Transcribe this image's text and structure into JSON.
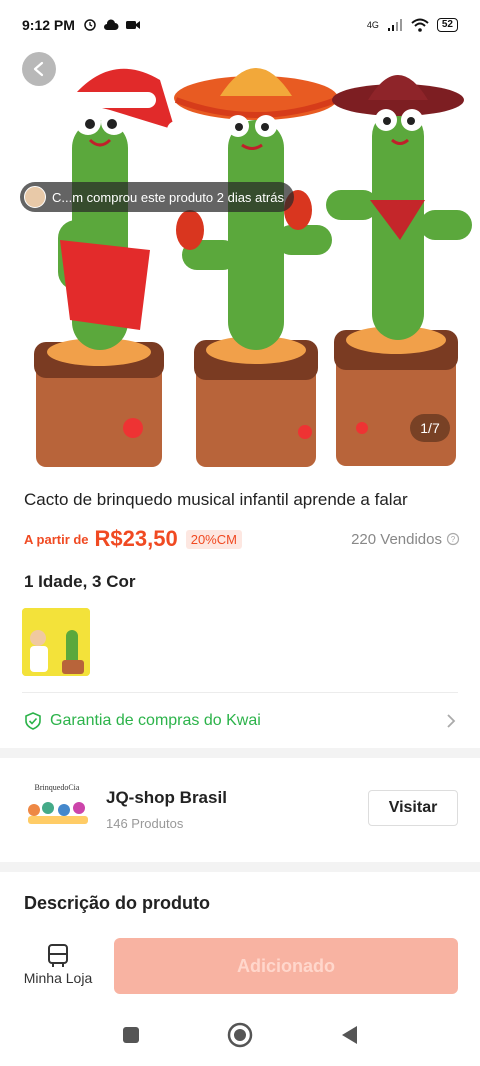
{
  "status_bar": {
    "time": "9:12 PM",
    "network": "4G",
    "battery": "52"
  },
  "hero": {
    "toast": "C...m comprou este produto 2 dias atrás",
    "page_indicator": "1/7"
  },
  "product": {
    "title": "Cacto de brinquedo musical infantil aprende a falar",
    "price_prefix": "A partir de",
    "price": "R$23,50",
    "discount": "20%CM",
    "sold": "220 Vendidos",
    "variants": "1 Idade, 3 Cor"
  },
  "guarantee": {
    "label": "Garantia de compras do Kwai"
  },
  "shop": {
    "logo_text": "BrinquedoCia",
    "name": "JQ-shop Brasil",
    "product_count": "146 Produtos",
    "visit_label": "Visitar"
  },
  "description": {
    "title": "Descrição do produto"
  },
  "bottom_bar": {
    "my_store_label": "Minha Loja",
    "add_label": "Adicionado"
  },
  "colors": {
    "accent": "#f04a22",
    "guarantee_green": "#2cb34a",
    "add_button_disabled": "#f8b3a2"
  },
  "icons": {
    "back": "back-arrow-icon",
    "guarantee": "shield-check-icon",
    "help": "question-icon",
    "store": "store-icon",
    "nav_recents": "square-icon",
    "nav_home": "circle-icon",
    "nav_back": "triangle-back-icon"
  }
}
